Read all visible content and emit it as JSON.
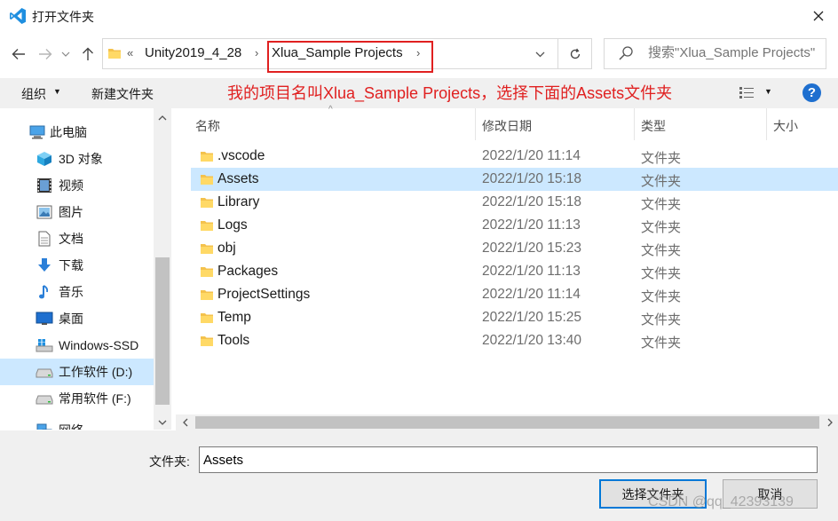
{
  "window": {
    "title": "打开文件夹"
  },
  "address": {
    "overflow": "«",
    "crumbs": [
      "Unity2019_4_28",
      "Xlua_Sample Projects"
    ],
    "separator": "›"
  },
  "search": {
    "placeholder": "搜索\"Xlua_Sample Projects\""
  },
  "toolbar": {
    "organize": "组织",
    "new_folder": "新建文件夹",
    "help": "?"
  },
  "annotation": "我的项目名叫Xlua_Sample Projects，选择下面的Assets文件夹",
  "nav_pane": {
    "items": [
      {
        "label": "此电脑",
        "icon": "computer-icon"
      },
      {
        "label": "3D 对象",
        "icon": "cube-icon"
      },
      {
        "label": "视频",
        "icon": "video-icon"
      },
      {
        "label": "图片",
        "icon": "picture-icon"
      },
      {
        "label": "文档",
        "icon": "document-icon"
      },
      {
        "label": "下载",
        "icon": "download-icon"
      },
      {
        "label": "音乐",
        "icon": "music-icon"
      },
      {
        "label": "桌面",
        "icon": "desktop-icon"
      },
      {
        "label": "Windows-SSD",
        "icon": "windows-drive-icon"
      },
      {
        "label": "工作软件 (D:)",
        "icon": "drive-icon",
        "selected": true
      },
      {
        "label": "常用软件 (F:)",
        "icon": "drive-icon"
      },
      {
        "label": "网络",
        "icon": "network-icon"
      }
    ]
  },
  "columns": {
    "name": "名称",
    "date": "修改日期",
    "type": "类型",
    "size": "大小"
  },
  "files": [
    {
      "name": ".vscode",
      "date": "2022/1/20 11:14",
      "type": "文件夹"
    },
    {
      "name": "Assets",
      "date": "2022/1/20 15:18",
      "type": "文件夹",
      "selected": true
    },
    {
      "name": "Library",
      "date": "2022/1/20 15:18",
      "type": "文件夹"
    },
    {
      "name": "Logs",
      "date": "2022/1/20 11:13",
      "type": "文件夹"
    },
    {
      "name": "obj",
      "date": "2022/1/20 15:23",
      "type": "文件夹"
    },
    {
      "name": "Packages",
      "date": "2022/1/20 11:13",
      "type": "文件夹"
    },
    {
      "name": "ProjectSettings",
      "date": "2022/1/20 11:14",
      "type": "文件夹"
    },
    {
      "name": "Temp",
      "date": "2022/1/20 15:25",
      "type": "文件夹"
    },
    {
      "name": "Tools",
      "date": "2022/1/20 13:40",
      "type": "文件夹"
    }
  ],
  "footer": {
    "filename_label": "文件夹:",
    "filename_value": "Assets",
    "select_button": "选择文件夹",
    "cancel_button": "取消"
  },
  "watermark": "CSDN @qq_42393139",
  "colors": {
    "accent": "#0078d7",
    "selection": "#cce8ff",
    "annotation_red": "#e02020",
    "folder_yellow": "#f4c24d",
    "help_blue": "#1e6fcf"
  }
}
